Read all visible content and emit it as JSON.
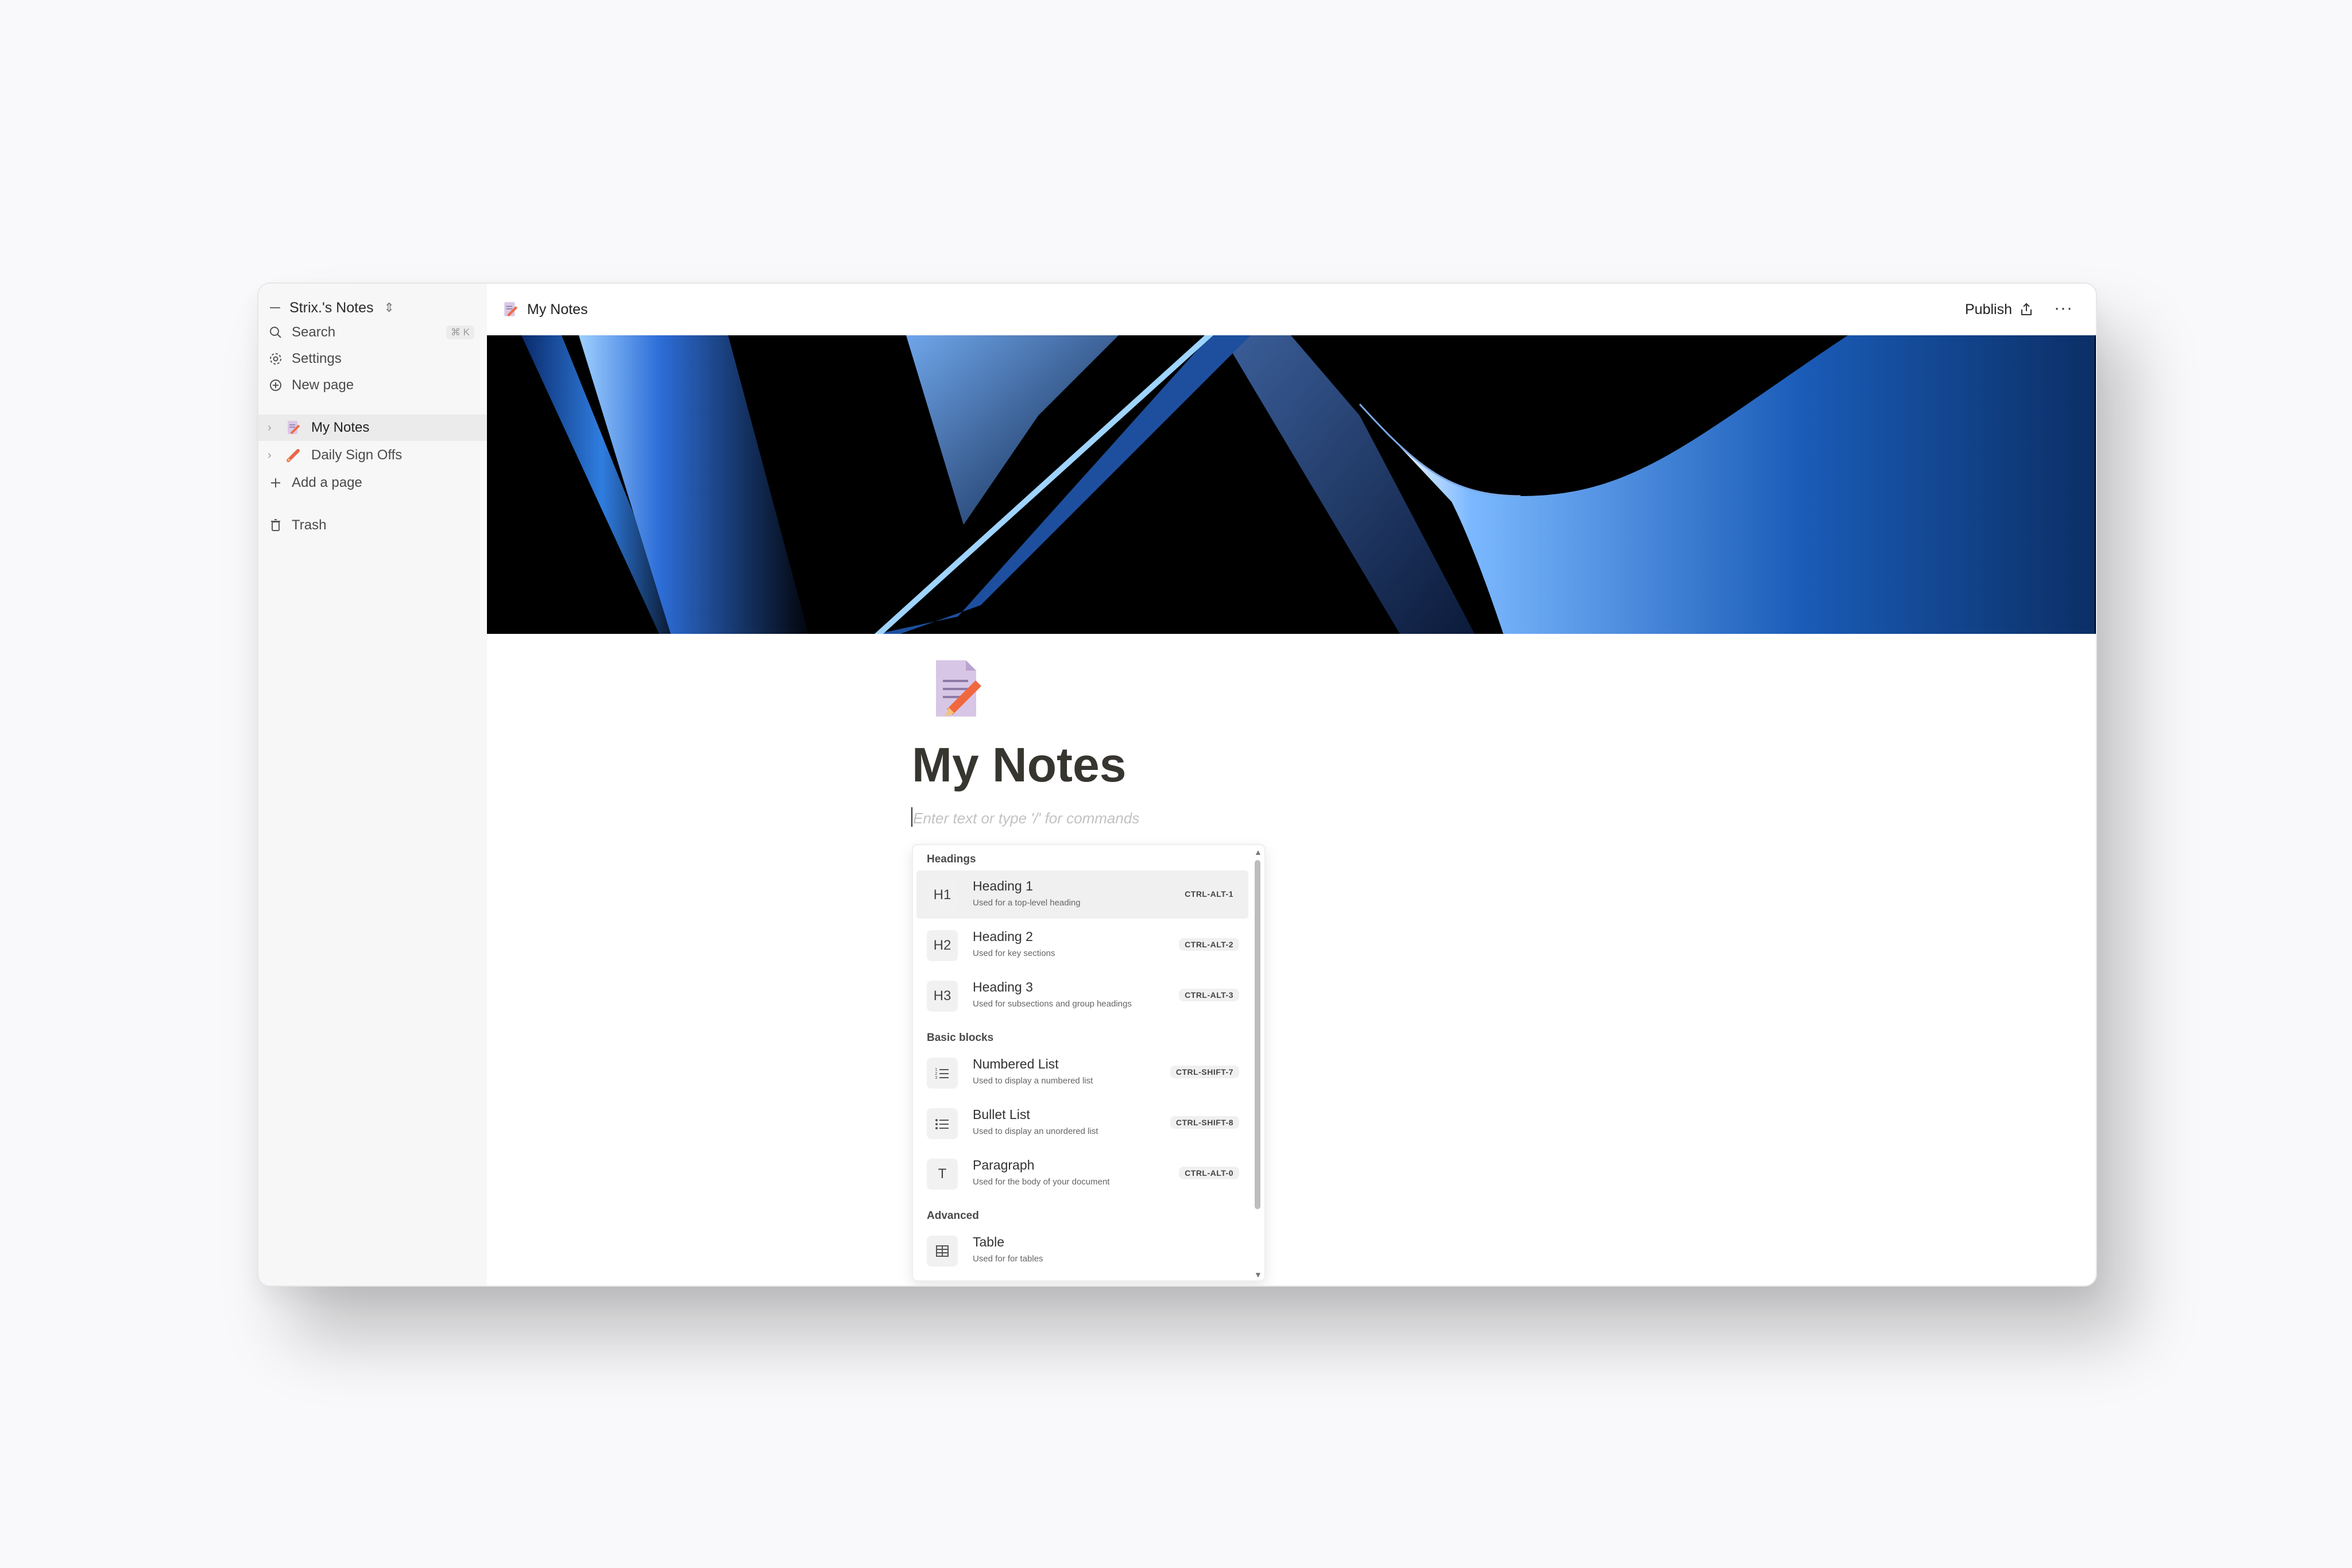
{
  "sidebar": {
    "workspace": "Strix.'s Notes",
    "search": "Search",
    "search_shortcut": "⌘ K",
    "settings": "Settings",
    "new_page": "New page",
    "pages": [
      {
        "label": "My Notes"
      },
      {
        "label": "Daily Sign Offs"
      }
    ],
    "add_page": "Add a page",
    "trash": "Trash"
  },
  "topbar": {
    "breadcrumb": "My Notes",
    "publish": "Publish",
    "more": "···"
  },
  "page": {
    "title": "My Notes",
    "placeholder": "Enter text or type '/' for commands"
  },
  "menu": {
    "sections": [
      {
        "heading": "Headings",
        "items": [
          {
            "icon": "H1",
            "label": "Heading 1",
            "desc": "Used for a top-level heading",
            "shortcut": "CTRL-ALT-1"
          },
          {
            "icon": "H2",
            "label": "Heading 2",
            "desc": "Used for key sections",
            "shortcut": "CTRL-ALT-2"
          },
          {
            "icon": "H3",
            "label": "Heading 3",
            "desc": "Used for subsections and group headings",
            "shortcut": "CTRL-ALT-3"
          }
        ]
      },
      {
        "heading": "Basic blocks",
        "items": [
          {
            "icon": "numbered-list-icon",
            "label": "Numbered List",
            "desc": "Used to display a numbered list",
            "shortcut": "CTRL-SHIFT-7"
          },
          {
            "icon": "bullet-list-icon",
            "label": "Bullet List",
            "desc": "Used to display an unordered list",
            "shortcut": "CTRL-SHIFT-8"
          },
          {
            "icon": "T",
            "label": "Paragraph",
            "desc": "Used for the body of your document",
            "shortcut": "CTRL-ALT-0"
          }
        ]
      },
      {
        "heading": "Advanced",
        "items": [
          {
            "icon": "table-icon",
            "label": "Table",
            "desc": "Used for for tables",
            "shortcut": ""
          }
        ]
      }
    ]
  }
}
